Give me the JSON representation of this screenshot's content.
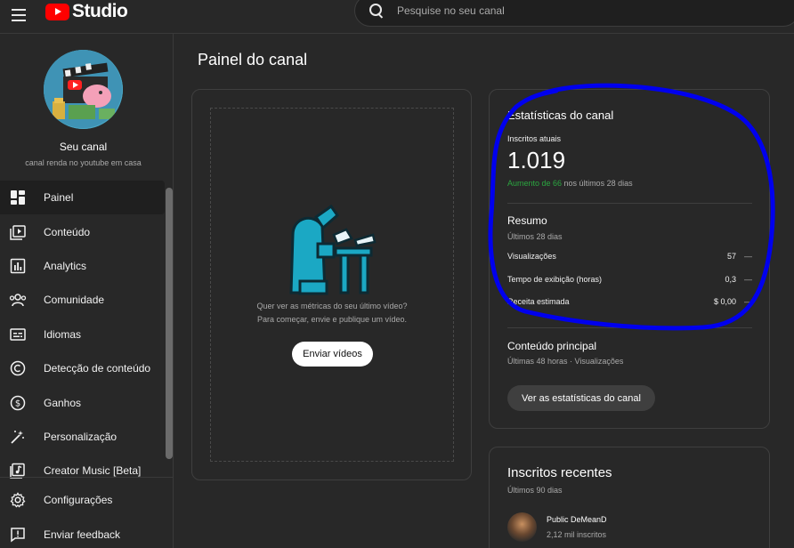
{
  "app": {
    "logo_text": "Studio"
  },
  "search": {
    "placeholder": "Pesquise no seu canal"
  },
  "channel": {
    "name": "Seu canal",
    "description": "canal renda no youtube em casa"
  },
  "sidebar": {
    "items": [
      {
        "label": "Painel",
        "icon": "dashboard-icon",
        "active": true
      },
      {
        "label": "Conteúdo",
        "icon": "content-icon"
      },
      {
        "label": "Analytics",
        "icon": "analytics-icon"
      },
      {
        "label": "Comunidade",
        "icon": "community-icon"
      },
      {
        "label": "Idiomas",
        "icon": "subtitles-icon"
      },
      {
        "label": "Detecção de conteúdo",
        "icon": "copyright-icon"
      },
      {
        "label": "Ganhos",
        "icon": "earn-icon"
      },
      {
        "label": "Personalização",
        "icon": "customization-icon"
      },
      {
        "label": "Creator Music [Beta]",
        "icon": "music-icon"
      }
    ],
    "bottom": [
      {
        "label": "Configurações",
        "icon": "gear-icon"
      },
      {
        "label": "Enviar feedback",
        "icon": "feedback-icon"
      }
    ]
  },
  "main": {
    "title": "Painel do canal",
    "upload": {
      "line1": "Quer ver as métricas do seu último vídeo?",
      "line2": "Para começar, envie e publique um vídeo.",
      "button": "Enviar vídeos"
    },
    "stats": {
      "title": "Estatísticas do canal",
      "subs_label": "Inscritos atuais",
      "subs_count": "1.019",
      "change_prefix": "Aumento de 66",
      "change_suffix": " nos últimos 28 dias",
      "summary_title": "Resumo",
      "summary_sub": "Últimos 28 dias",
      "metrics": [
        {
          "label": "Visualizações",
          "value": "57",
          "trend": "—"
        },
        {
          "label": "Tempo de exibição (horas)",
          "value": "0,3",
          "trend": "—"
        },
        {
          "label": "Receita estimada",
          "value": "$ 0,00",
          "trend": "—"
        }
      ],
      "top_title": "Conteúdo principal",
      "top_sub": "Últimas 48 horas · Visualizações",
      "button": "Ver as estatísticas do canal"
    },
    "recent": {
      "title": "Inscritos recentes",
      "sub": "Últimos 90 dias",
      "subscriber": {
        "name": "Public DeMeanD",
        "count": "2,12 mil inscritos"
      }
    }
  },
  "colors": {
    "accent_green": "#2ba640",
    "annotation": "#0000ee",
    "brand_red": "#ff0000"
  }
}
